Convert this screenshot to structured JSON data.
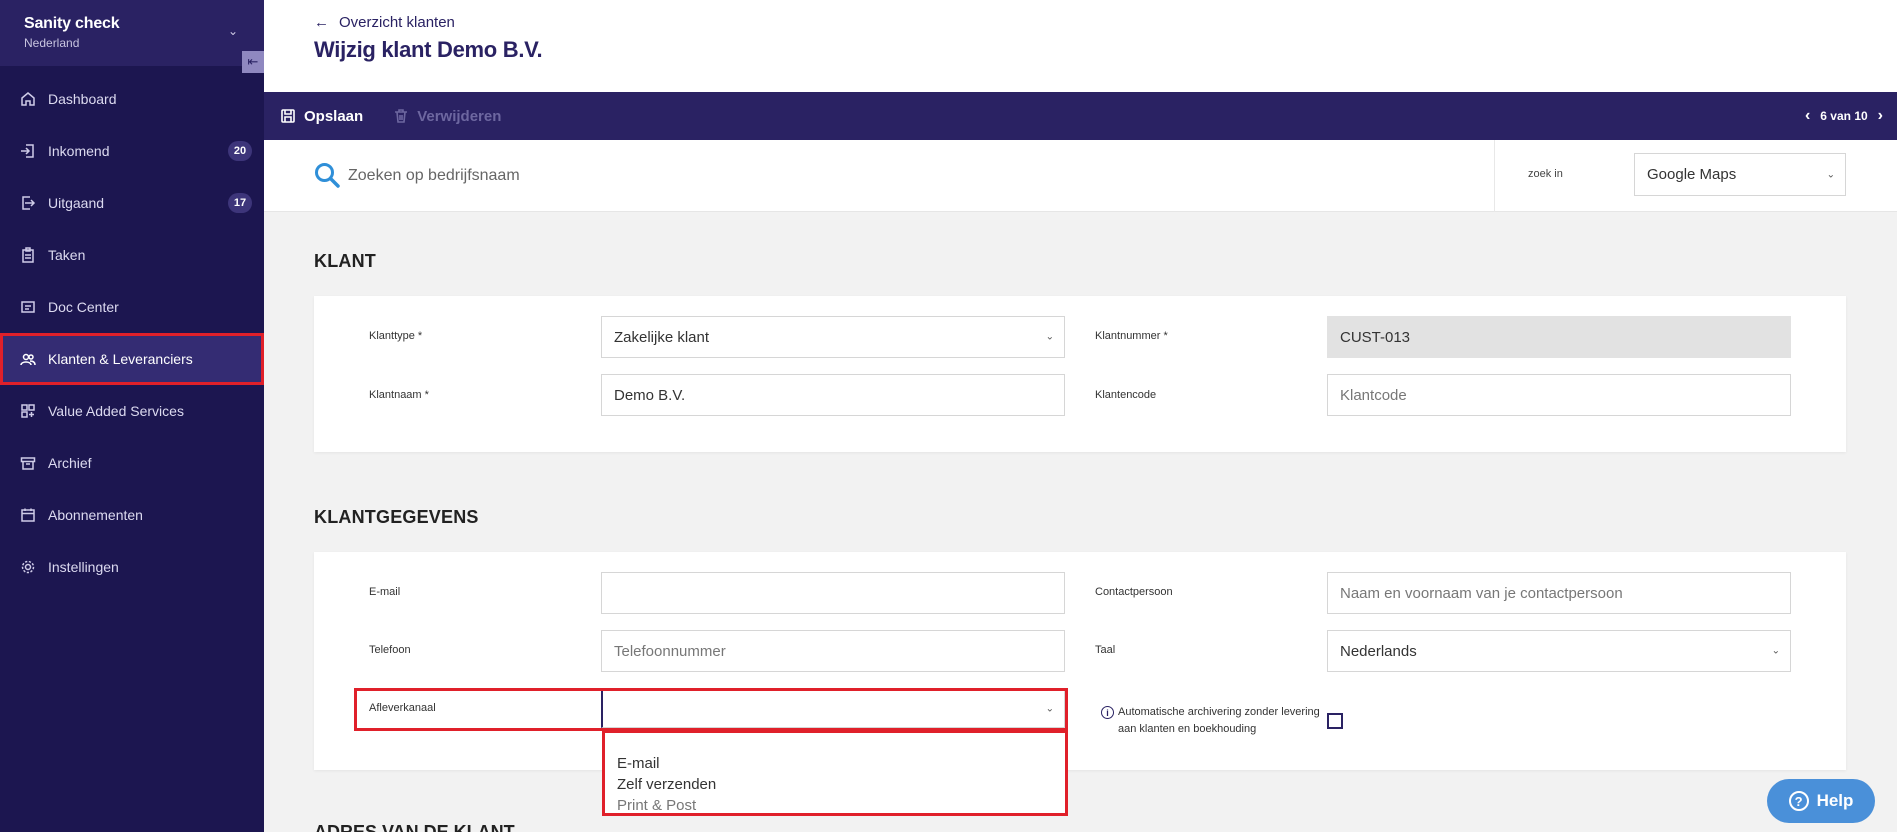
{
  "sidebar": {
    "org_name": "Sanity check",
    "org_country": "Nederland",
    "items": [
      {
        "label": "Dashboard",
        "icon": "home-icon"
      },
      {
        "label": "Inkomend",
        "icon": "inbox-in-icon",
        "badge": "20"
      },
      {
        "label": "Uitgaand",
        "icon": "outbox-icon",
        "badge": "17"
      },
      {
        "label": "Taken",
        "icon": "clipboard-icon"
      },
      {
        "label": "Doc Center",
        "icon": "doc-center-icon"
      },
      {
        "label": "Klanten & Leveranciers",
        "icon": "users-icon",
        "active": true
      },
      {
        "label": "Value Added Services",
        "icon": "grid-plus-icon"
      },
      {
        "label": "Archief",
        "icon": "archive-icon"
      },
      {
        "label": "Abonnementen",
        "icon": "calendar-icon"
      },
      {
        "label": "Instellingen",
        "icon": "gear-icon"
      }
    ]
  },
  "header": {
    "back_label": "Overzicht klanten",
    "title": "Wijzig klant Demo B.V."
  },
  "toolbar": {
    "save_label": "Opslaan",
    "delete_label": "Verwijderen",
    "pager_label": "6 van 10"
  },
  "search": {
    "placeholder": "Zoeken op bedrijfsnaam",
    "zoek_in_label": "zoek in",
    "source": "Google Maps"
  },
  "klant": {
    "section_title": "KLANT",
    "klanttype_label": "Klanttype *",
    "klanttype_value": "Zakelijke klant",
    "klantnummer_label": "Klantnummer *",
    "klantnummer_value": "CUST-013",
    "klantnaam_label": "Klantnaam *",
    "klantnaam_value": "Demo B.V.",
    "klantencode_label": "Klantencode",
    "klantcode_placeholder": "Klantcode"
  },
  "klantgegevens": {
    "section_title": "KLANTGEGEVENS",
    "email_label": "E-mail",
    "email_value": "",
    "contact_label": "Contactpersoon",
    "contact_placeholder": "Naam en voornaam van je contactpersoon",
    "telefoon_label": "Telefoon",
    "telefoon_placeholder": "Telefoonnummer",
    "taal_label": "Taal",
    "taal_value": "Nederlands",
    "afleverkanaal_label": "Afleverkanaal",
    "afleverkanaal_value": "",
    "afleverkanaal_options": [
      "E-mail",
      "Zelf verzenden",
      "Print & Post"
    ],
    "archivering_text": "Automatische archivering zonder levering aan klanten en boekhouding"
  },
  "next_section_title": "ADRES VAN DE KLANT",
  "help_label": "Help",
  "colors": {
    "sidebar_bg": "#1c1650",
    "brand": "#2a2263",
    "highlight": "#e0202a",
    "help": "#4a90d9"
  }
}
